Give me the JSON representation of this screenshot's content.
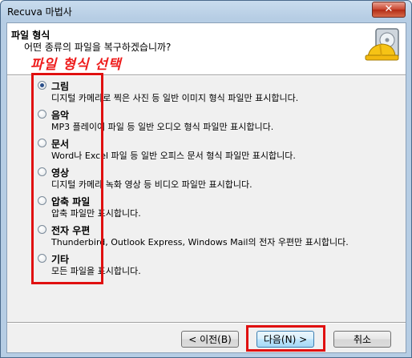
{
  "window": {
    "title": "Recuva 마법사",
    "close_label": "✕"
  },
  "header": {
    "title": "파일 형식",
    "subtitle": "어떤 종류의 파일을 복구하겠습니까?",
    "annotation": "파일 형식 선택"
  },
  "options": [
    {
      "label": "그림",
      "desc": "디지털 카메라로 찍은 사진 등 일반 이미지 형식 파일만 표시합니다.",
      "checked": true
    },
    {
      "label": "음악",
      "desc": "MP3 플레이어 파일 등 일반 오디오 형식 파일만 표시합니다.",
      "checked": false
    },
    {
      "label": "문서",
      "desc": "Word나 Excel 파일 등 일반 오피스 문서 형식 파일만 표시합니다.",
      "checked": false
    },
    {
      "label": "영상",
      "desc": "디지털 카메라 녹화 영상 등 비디오 파일만 표시합니다.",
      "checked": false
    },
    {
      "label": "압축 파일",
      "desc": "압축 파일만 표시합니다.",
      "checked": false
    },
    {
      "label": "전자 우편",
      "desc": "Thunderbird, Outlook Express, Windows Mail의 전자 우편만 표시합니다.",
      "checked": false
    },
    {
      "label": "기타",
      "desc": "모든 파일을 표시합니다.",
      "checked": false
    }
  ],
  "buttons": {
    "back": "< 이전(B)",
    "next": "다음(N) >",
    "cancel": "취소"
  },
  "colors": {
    "annotation": "#ee1c1c",
    "highlight_box": "#e01010",
    "radio_dot": "#2a4f8a"
  }
}
